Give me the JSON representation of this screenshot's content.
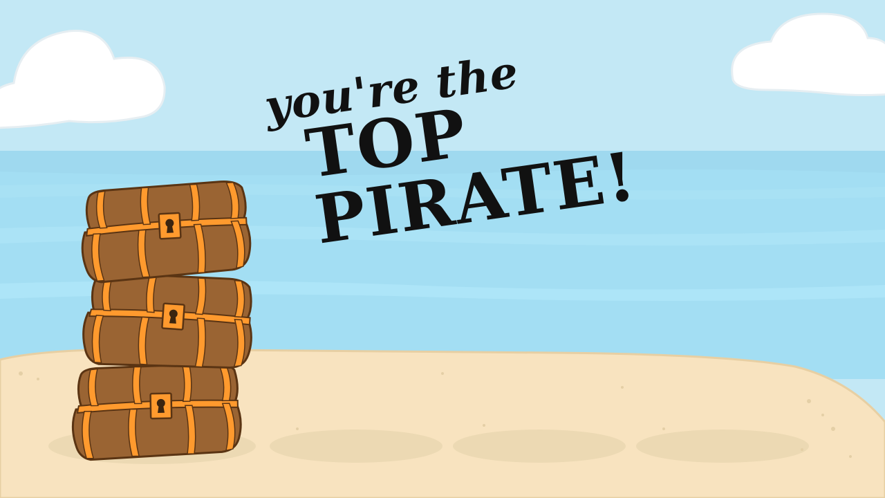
{
  "screen": {
    "name": "victory-screen",
    "title_line1": "you're the",
    "title_line2": "TOP PIRATE!"
  },
  "colors": {
    "sky": "#c3e8f5",
    "sea_far": "#9fdcf2",
    "sea_near": "#a9e4f7",
    "sand": "#f8e3bf",
    "sand_shadow": "#ecd9b3",
    "chest_wood": "#9a6433",
    "chest_band": "#ff9a2e",
    "chest_outline": "#5a3413",
    "text": "#111111"
  },
  "scene": {
    "chest_stack_count": 3,
    "empty_slots": 3
  }
}
